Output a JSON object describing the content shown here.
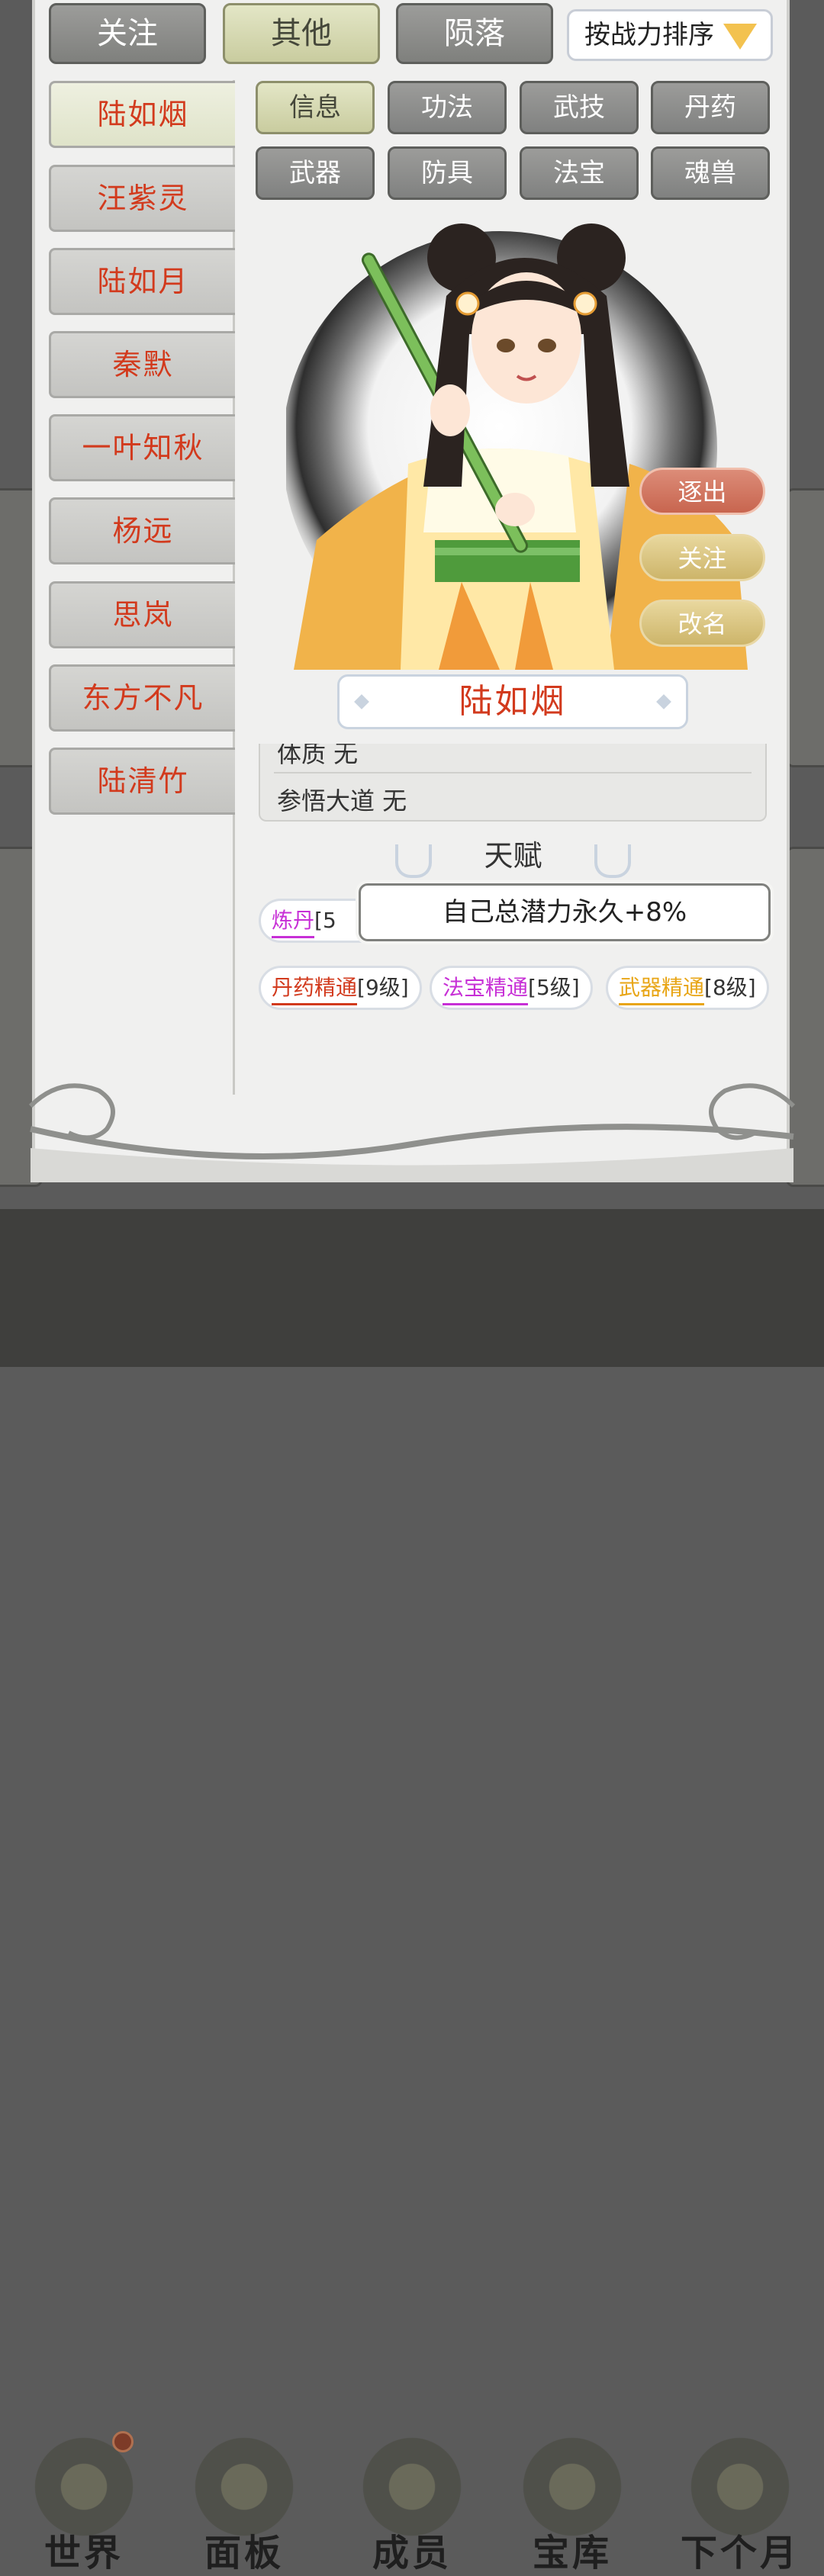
{
  "top_tabs": [
    {
      "label": "关注",
      "active": false
    },
    {
      "label": "其他",
      "active": true
    },
    {
      "label": "陨落",
      "active": false
    }
  ],
  "sort": {
    "label": "按战力排序"
  },
  "members": [
    "陆如烟",
    "汪紫灵",
    "陆如月",
    "秦默",
    "一叶知秋",
    "杨远",
    "思岚",
    "东方不凡",
    "陆清竹"
  ],
  "sub_tabs": [
    "信息",
    "功法",
    "武技",
    "丹药",
    "武器",
    "防具",
    "法宝",
    "魂兽"
  ],
  "actions": {
    "exit": "逐出",
    "follow": "关注",
    "rename": "改名"
  },
  "character": {
    "name": "陆如烟"
  },
  "info": {
    "constitution": "体质 无",
    "comprehension": "参悟大道 无"
  },
  "talent": {
    "title": "天赋",
    "tooltip": "自己总潜力永久+8%",
    "skills": [
      {
        "name": "炼丹",
        "level": "[5级]",
        "level_visible": "[5",
        "color": "#c72fd6"
      },
      {
        "name": "丹药精通",
        "level": "[9级]",
        "color": "#d23a1d"
      },
      {
        "name": "法宝精通",
        "level": "[5级]",
        "color": "#c72fd6"
      },
      {
        "name": "武器精通",
        "level": "[8级]",
        "color": "#e8a515"
      }
    ]
  },
  "bottom_nav": [
    "世界",
    "面板",
    "成员",
    "宝库",
    "下个月"
  ],
  "colors": {
    "member_name": "#d23a1d",
    "exit_button": "#c8654f",
    "gold_button": "#cdb56a"
  }
}
